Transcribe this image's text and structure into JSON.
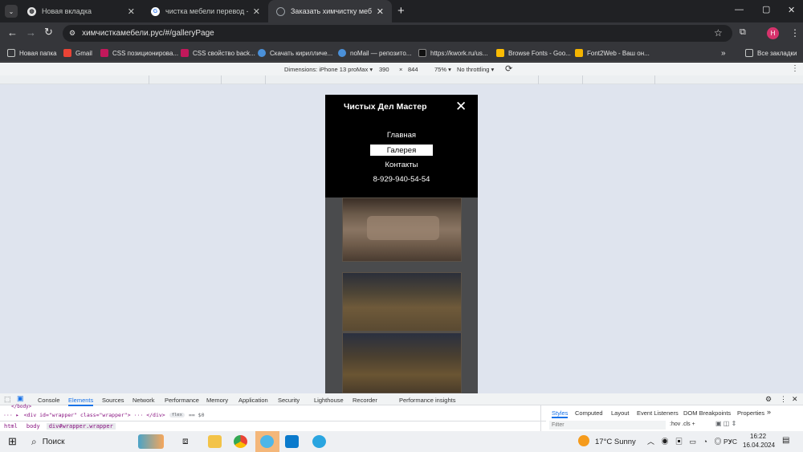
{
  "tabs": [
    {
      "title": "Новая вкладка",
      "active": false
    },
    {
      "title": "чистка мебели перевод - Пои",
      "active": false
    },
    {
      "title": "Заказать химчистку мебели н",
      "active": true
    }
  ],
  "new_tab_symbol": "+",
  "close_symbol": "✕",
  "window_controls": {
    "minimize": "—",
    "maximize": "▢",
    "close": "✕"
  },
  "address": {
    "url": "химчисткамебели.рус/#/galleryPage"
  },
  "profile_initial": "Н",
  "bookmarks": [
    {
      "label": "Новая папка",
      "icon": "folder-icon"
    },
    {
      "label": "Gmail",
      "icon": "gmail-icon"
    },
    {
      "label": "CSS позиционирова...",
      "icon": "css-icon"
    },
    {
      "label": "CSS свойство back...",
      "icon": "css-icon"
    },
    {
      "label": "Скачать кирилличе...",
      "icon": "cloud-icon"
    },
    {
      "label": "noMail — репозито...",
      "icon": "cloud-icon"
    },
    {
      "label": "https://kwork.ru/us...",
      "icon": "kwork-icon"
    },
    {
      "label": "Browse Fonts - Goo...",
      "icon": "google-fonts-icon"
    },
    {
      "label": "Font2Web - Ваш он...",
      "icon": "font2web-icon"
    }
  ],
  "bookmarks_more": "»",
  "all_bookmarks": "Все закладки",
  "device_toolbar": {
    "dimensions_label": "Dimensions: iPhone 13 proMax",
    "width": "390",
    "times": "×",
    "height": "844",
    "zoom": "75%",
    "throttling": "No throttling"
  },
  "site": {
    "brand": "Чистых Дел Мастер",
    "close": "✕",
    "menu": [
      {
        "label": "Главная",
        "selected": false
      },
      {
        "label": "Галерея",
        "selected": true
      },
      {
        "label": "Контакты",
        "selected": false
      },
      {
        "label": "8-929-940-54-54",
        "selected": false
      }
    ]
  },
  "devtools": {
    "tabs": [
      "Console",
      "Elements",
      "Sources",
      "Network",
      "Performance",
      "Memory",
      "Application",
      "Security",
      "Lighthouse",
      "Recorder",
      "Performance insights"
    ],
    "active_tab": "Elements",
    "dom_body_line": "</body>",
    "dom_line": "<div id=\"wrapper\" class=\"wrapper\"> ··· </div>",
    "dom_flex_badge": "flex",
    "dom_dollar": "== $0",
    "breadcrumbs": [
      "html",
      "body",
      "div#wrapper.wrapper"
    ],
    "style_tabs": [
      "Styles",
      "Computed",
      "Layout",
      "Event Listeners",
      "DOM Breakpoints",
      "Properties"
    ],
    "filter_placeholder": "Filter",
    "filter_tools": ":hov  .cls  +"
  },
  "taskbar": {
    "search": "Поиск",
    "weather": "17°C  Sunny",
    "lang": "РУС",
    "time": "16:22",
    "date": "16.04.2024"
  }
}
